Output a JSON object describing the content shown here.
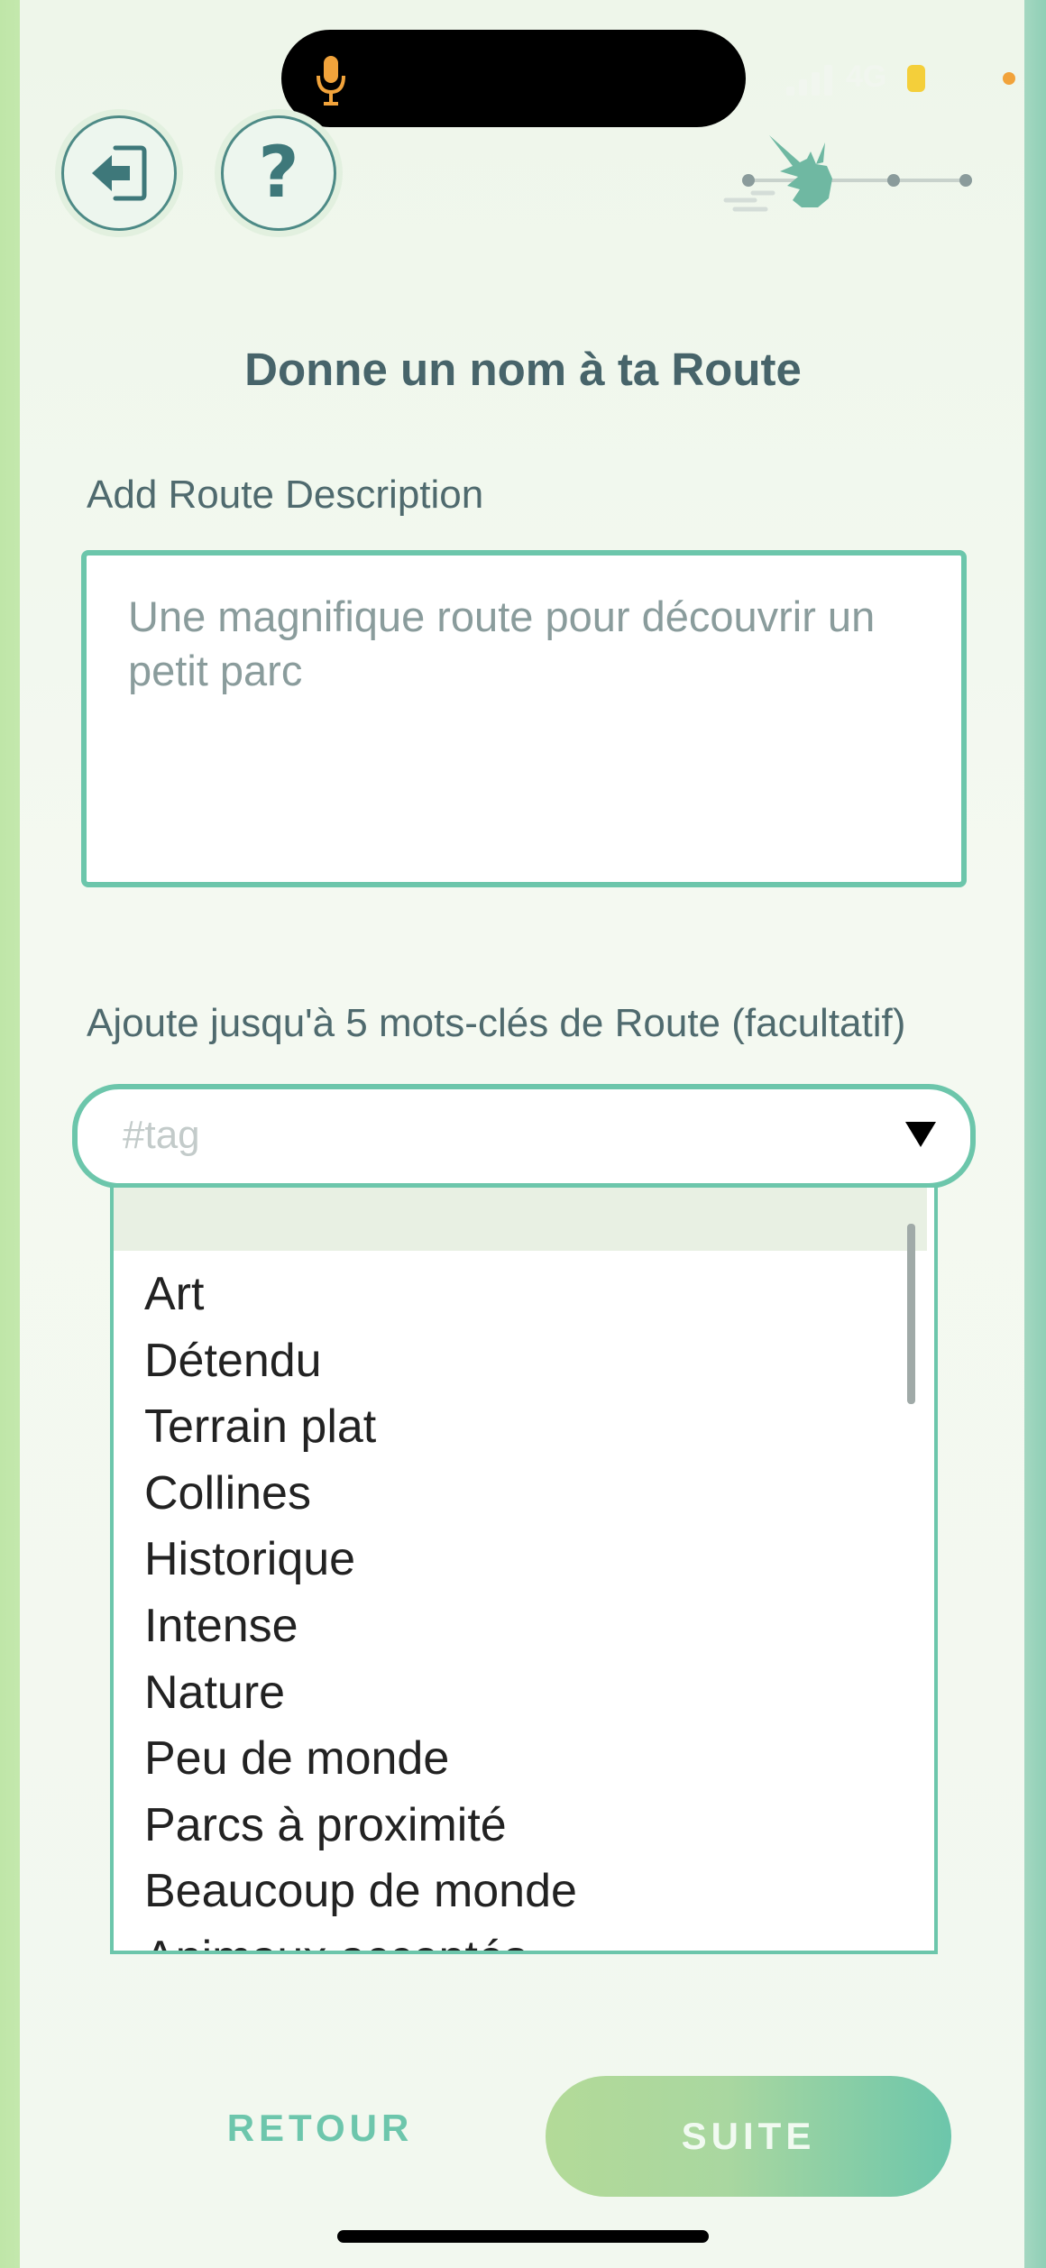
{
  "status_bar": {
    "network": "4G",
    "icons": [
      "microphone-icon",
      "signal-icon",
      "battery-icon"
    ],
    "colors": {
      "mic": "#f1a33b",
      "battery": "#f4cf3a",
      "privacy_dot": "#f1a33b"
    }
  },
  "header": {
    "exit_icon": "exit-icon",
    "help_glyph": "?",
    "progress_icon": "pikachu-running-icon",
    "progress_steps_total": 3
  },
  "main": {
    "title": "Donne un nom à ta Route",
    "description": {
      "label": "Add Route Description",
      "value": "Une magnifique route pour découvrir un petit parc"
    },
    "tags": {
      "label": "Ajoute jusqu'à 5 mots-clés de Route (facultatif)",
      "placeholder": "#tag",
      "options": [
        "Art",
        "Détendu",
        "Terrain plat",
        "Collines",
        "Historique",
        "Intense",
        "Nature",
        "Peu de monde",
        "Parcs à proximité",
        "Beaucoup de monde",
        "Animaux acceptés"
      ]
    }
  },
  "footer": {
    "back_label": "RETOUR",
    "next_label": "SUITE"
  },
  "colors": {
    "accent": "#6cc6ab",
    "title_text": "#47646a",
    "icon_stroke": "#4d8a86"
  }
}
